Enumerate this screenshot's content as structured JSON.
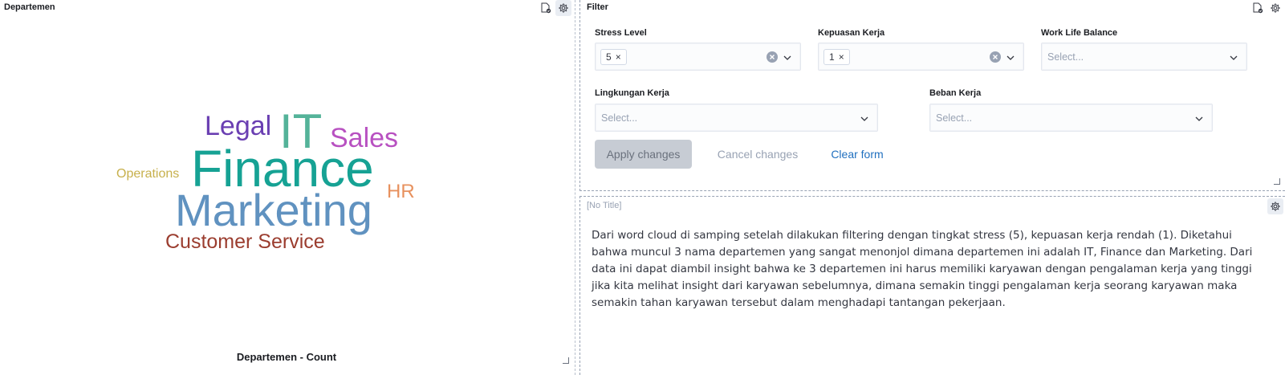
{
  "left_panel": {
    "title": "Departemen",
    "caption": "Departemen - Count"
  },
  "chart_data": {
    "type": "wordcloud",
    "words": [
      {
        "text": "IT",
        "color": "#54b399"
      },
      {
        "text": "Finance",
        "color": "#16a294"
      },
      {
        "text": "Marketing",
        "color": "#6092c0"
      },
      {
        "text": "Legal",
        "color": "#6a3fb2"
      },
      {
        "text": "Sales",
        "color": "#b851c1"
      },
      {
        "text": "Customer Service",
        "color": "#9b3d2f"
      },
      {
        "text": "Operations",
        "color": "#c7b04c"
      },
      {
        "text": "HR",
        "color": "#e7915e"
      }
    ]
  },
  "filter_panel": {
    "title": "Filter",
    "fields": [
      {
        "label": "Stress Level",
        "chip": "5",
        "placeholder": ""
      },
      {
        "label": "Kepuasan Kerja",
        "chip": "1",
        "placeholder": ""
      },
      {
        "label": "Work Life Balance",
        "chip": "",
        "placeholder": "Select..."
      },
      {
        "label": "Lingkungan Kerja",
        "chip": "",
        "placeholder": "Select..."
      },
      {
        "label": "Beban Kerja",
        "chip": "",
        "placeholder": "Select..."
      }
    ],
    "apply_label": "Apply changes",
    "cancel_label": "Cancel changes",
    "clear_label": "Clear form"
  },
  "text_panel": {
    "title": "[No Title]",
    "body": "Dari word cloud di samping setelah dilakukan filtering dengan tingkat stress (5), kepuasan kerja rendah (1). Diketahui bahwa muncul 3 nama departemen yang sangat menonjol dimana departemen ini adalah IT, Finance dan Marketing. Dari data ini dapat diambil insight bahwa ke 3 departemen ini harus memiliki karyawan dengan pengalaman kerja yang tinggi jika kita melihat insight dari karyawan sebelumnya, dimana semakin tinggi pengalaman kerja seorang karyawan maka semakin tahan karyawan tersebut dalam menghadapi tantangan pekerjaan."
  },
  "icons": {
    "panel_options": "gear-icon",
    "data_table": "document-check-icon",
    "chip_remove": "close-icon",
    "clear": "clear-icon",
    "dropdown": "chevron-down-icon"
  }
}
